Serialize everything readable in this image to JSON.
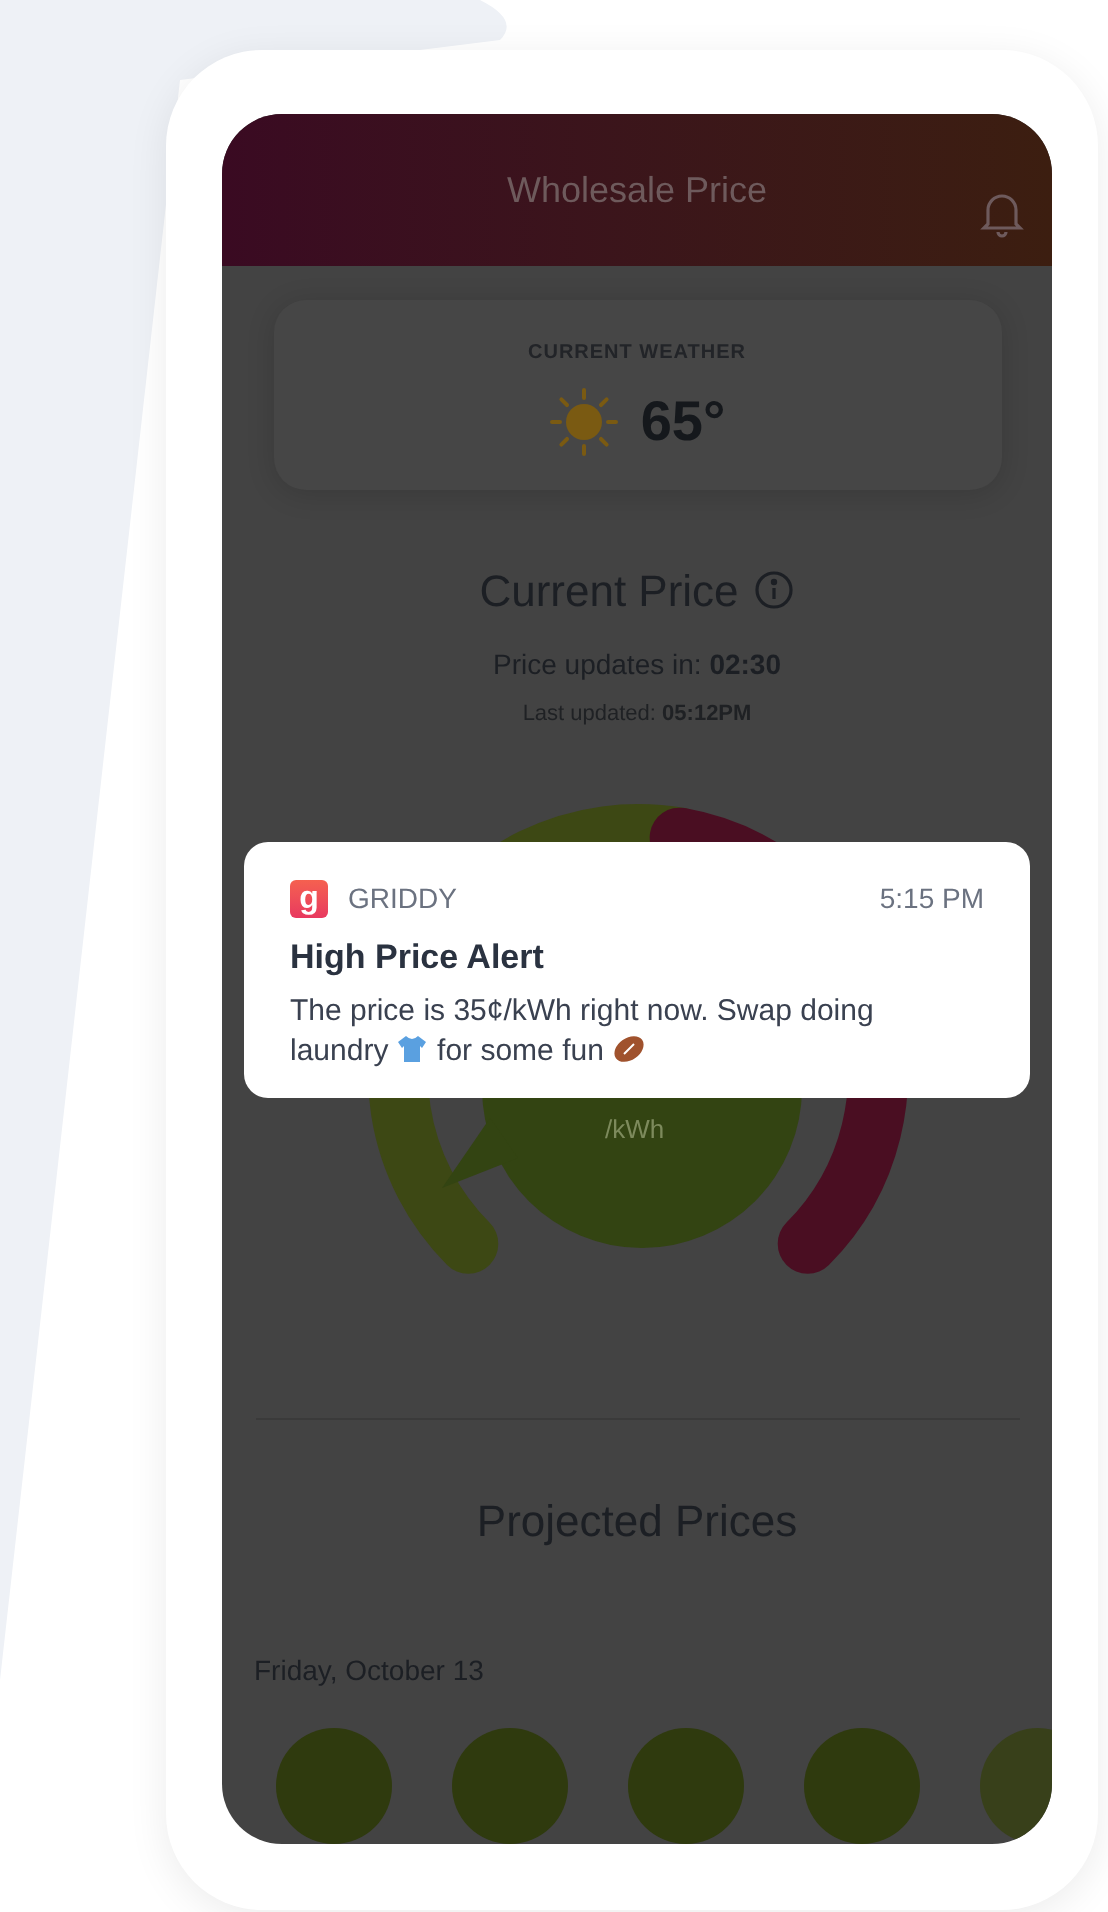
{
  "header": {
    "title": "Wholesale Price"
  },
  "weather": {
    "label": "CURRENT WEATHER",
    "temperature": "65°"
  },
  "current_price": {
    "title": "Current Price",
    "updates_label": "Price updates in:",
    "updates_value": "02:30",
    "last_updated_label": "Last updated:",
    "last_updated_value": "05:12PM",
    "unit": "/kWh"
  },
  "notification": {
    "app_letter": "g",
    "app_name": "GRIDDY",
    "time": "5:15 PM",
    "title": "High Price Alert",
    "body_parts": [
      "The price is 35¢/kWh right now. Swap doing laundry",
      "for some fun"
    ]
  },
  "projected": {
    "title": "Projected Prices",
    "date": "Friday, October 13"
  }
}
